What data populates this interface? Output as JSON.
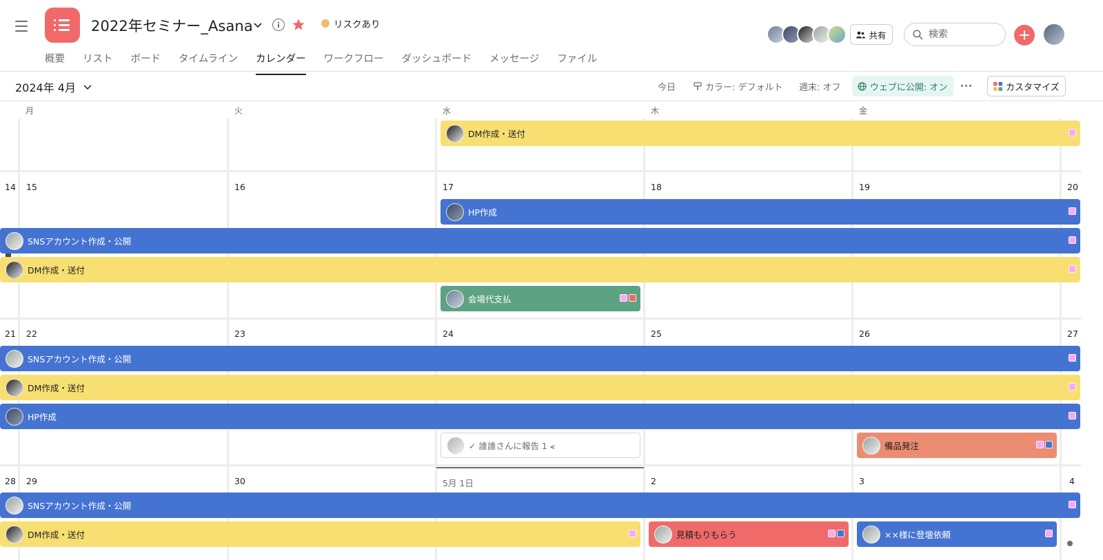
{
  "header": {
    "project_title": "2022年セミナー_Asana",
    "status": {
      "label": "リスクあり",
      "color": "#f1bd6c"
    },
    "share_label": "共有",
    "search_placeholder": "検索",
    "brand_color": "#f06a6a"
  },
  "tabs": [
    {
      "label": "概要"
    },
    {
      "label": "リスト"
    },
    {
      "label": "ボード"
    },
    {
      "label": "タイムライン"
    },
    {
      "label": "カレンダー",
      "active": true
    },
    {
      "label": "ワークフロー"
    },
    {
      "label": "ダッシュボード"
    },
    {
      "label": "メッセージ"
    },
    {
      "label": "ファイル"
    }
  ],
  "toolbar": {
    "month": "2024年 4月",
    "today": "今日",
    "color": "カラー: デフォルト",
    "weekend": "週末: オフ",
    "publish": "ウェブに公開: オン",
    "customize": "カスタマイズ"
  },
  "weekdays": [
    "月",
    "火",
    "水",
    "木",
    "金"
  ],
  "day_numbers": {
    "w2": [
      "14",
      "15",
      "16",
      "17",
      "18",
      "19",
      "20"
    ],
    "w3": [
      "21",
      "22",
      "23",
      "24",
      "25",
      "26",
      "27"
    ],
    "w4": [
      "28",
      "29",
      "30",
      "5月 1日",
      "2",
      "3",
      "4"
    ]
  },
  "events": [
    {
      "id": "e1",
      "title": "DM作成・送付",
      "color": "yellow"
    },
    {
      "id": "e2",
      "title": "HP作成",
      "color": "blue"
    },
    {
      "id": "e3",
      "title": "SNSアカウント作成・公開",
      "color": "blue"
    },
    {
      "id": "e4",
      "title": "DM作成・送付",
      "color": "yellow"
    },
    {
      "id": "e5",
      "title": "会場代支払",
      "color": "green"
    },
    {
      "id": "e6",
      "title": "SNSアカウント作成・公開",
      "color": "blue"
    },
    {
      "id": "e7",
      "title": "DM作成・送付",
      "color": "yellow"
    },
    {
      "id": "e8",
      "title": "HP作成",
      "color": "blue"
    },
    {
      "id": "e9",
      "title": "✓ 誰誰さんに報告 1 ⪪",
      "color": "white"
    },
    {
      "id": "e10",
      "title": "備品発注",
      "color": "salmon"
    },
    {
      "id": "e11",
      "title": "SNSアカウント作成・公開",
      "color": "blue"
    },
    {
      "id": "e12",
      "title": "DM作成・送付",
      "color": "yellow"
    },
    {
      "id": "e13",
      "title": "見積もりもらう",
      "color": "red"
    },
    {
      "id": "e14",
      "title": "××様に登壇依頼",
      "color": "blue"
    }
  ],
  "tag_colors": {
    "pink": "#f9aaef",
    "red": "#f06a6a",
    "blue": "#4573d2"
  }
}
